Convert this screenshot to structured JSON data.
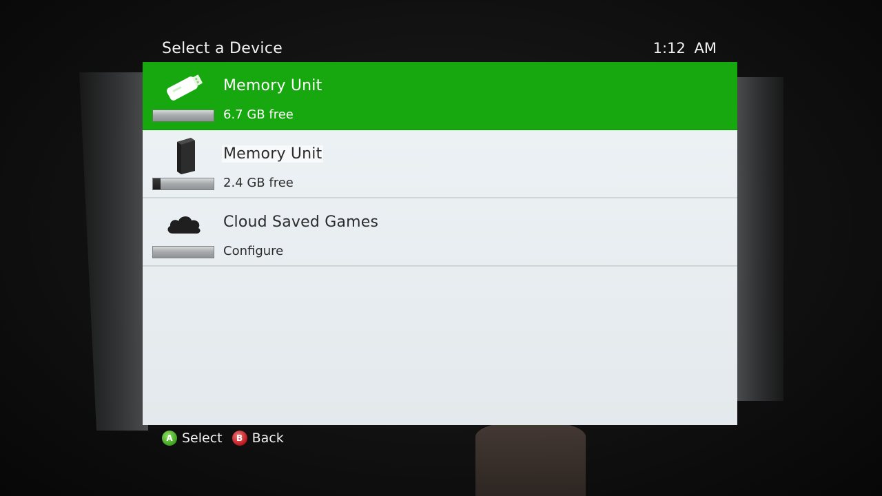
{
  "header": {
    "title": "Select a Device",
    "clock": "1:12 AM"
  },
  "devices": [
    {
      "name": "Memory Unit",
      "status": "6.7 GB free",
      "icon": "usb-drive-icon",
      "selected": true,
      "used_fraction": 0.0
    },
    {
      "name": "Memory Unit",
      "status": "2.4 GB free",
      "icon": "hard-drive-icon",
      "selected": false,
      "used_fraction": 0.13
    },
    {
      "name": "Cloud Saved Games",
      "status": "Configure",
      "icon": "cloud-icon",
      "selected": false,
      "used_fraction": 0.0
    }
  ],
  "footer": {
    "select": {
      "glyph": "A",
      "label": "Select"
    },
    "back": {
      "glyph": "B",
      "label": "Back"
    }
  },
  "colors": {
    "selected_row": "#17a80f",
    "button_a": "#3fa21e",
    "button_b": "#b8161c"
  }
}
